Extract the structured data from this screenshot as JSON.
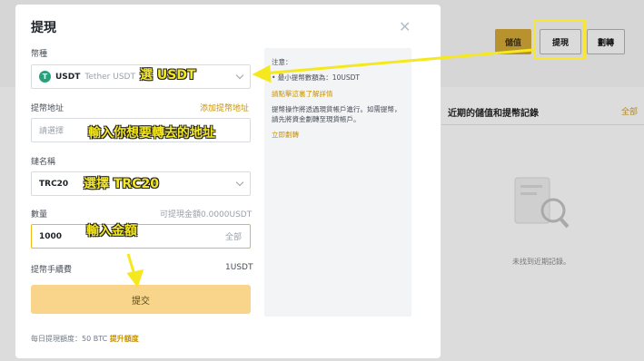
{
  "background": {
    "buttons": {
      "deposit": "儲值",
      "withdraw": "提現",
      "transfer": "劃轉"
    },
    "records": {
      "title": "近期的儲值和提幣記錄",
      "all": "全部",
      "empty": "未找到近期記錄。"
    }
  },
  "modal": {
    "title": "提現",
    "coin": {
      "label": "幣種",
      "code": "USDT",
      "name": "Tether USDT"
    },
    "address": {
      "label": "提幣地址",
      "link": "添加提幣地址",
      "placeholder": "請選擇"
    },
    "network": {
      "label": "鏈名稱",
      "value": "TRC20"
    },
    "amount": {
      "label": "數量",
      "available": "可提現金額0.0000USDT",
      "value": "1000",
      "all": "全部"
    },
    "fee": {
      "label": "提幣手續費",
      "value": "1USDT"
    },
    "submit": "提交",
    "limit": {
      "text": "每日提現額度：50 BTC",
      "link": "提升額度"
    }
  },
  "notes": {
    "title": "注意：",
    "min": "• 最小提幣數額為：10USDT",
    "details_link": "請點擊這裏了解詳情",
    "info": "提幣操作將透過現貨帳戶進行。如需提幣，請先將資金劃轉至現貨帳戶。",
    "transfer_link": "立即劃轉"
  },
  "annotations": {
    "select_usdt": "選 USDT",
    "enter_address": "輸入你想要轉去的地址",
    "select_trc20": "選擇 TRC20",
    "enter_amount": "輸入金額"
  },
  "colors": {
    "accent": "#c99400",
    "submit": "#f8d58a",
    "annotation": "#f5e81e",
    "tether": "#26a17b"
  }
}
